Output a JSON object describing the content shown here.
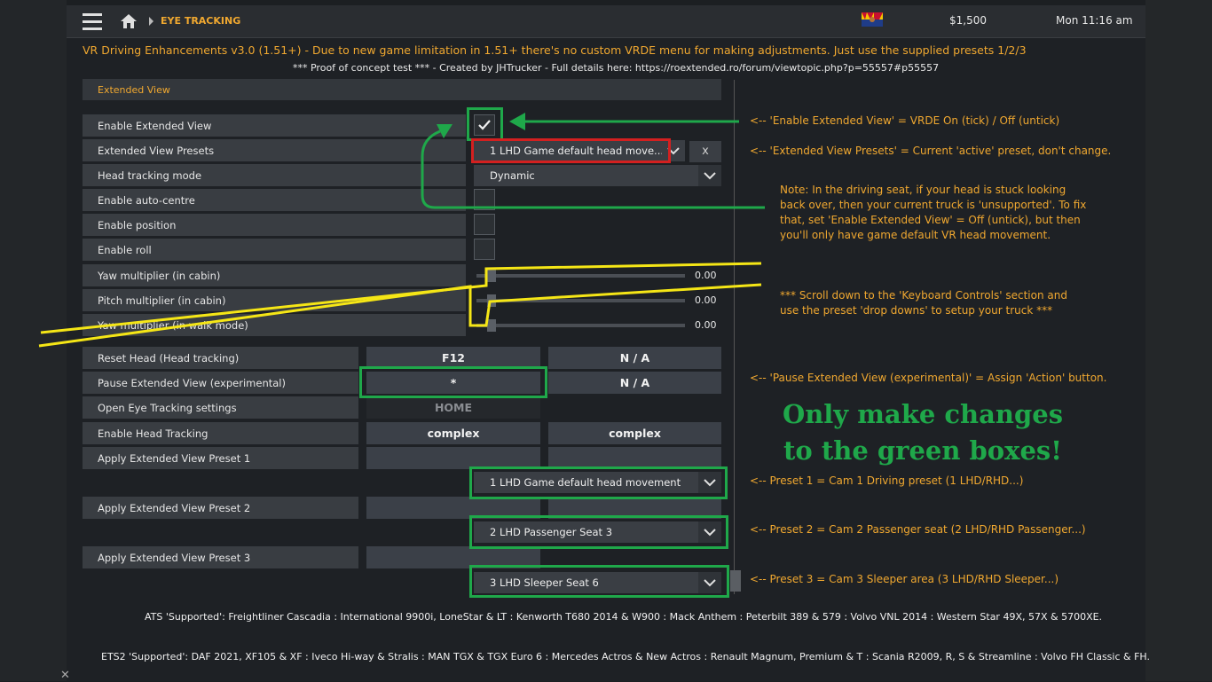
{
  "topbar": {
    "breadcrumb": "EYE TRACKING",
    "money": "$1,500",
    "clock": "Mon 11:16 am"
  },
  "header": {
    "title": "VR Driving Enhancements v3.0 (1.51+) - Due to new game limitation in 1.51+ there's no custom VRDE menu for making adjustments. Just use the supplied presets 1/2/3",
    "subtitle": "*** Proof of concept test *** - Created by JHTrucker - Full details here: https://roextended.ro/forum/viewtopic.php?p=55557#p55557"
  },
  "section": {
    "title": "Extended View"
  },
  "settings": {
    "enable_extended_view": "Enable Extended View",
    "extended_view_presets": "Extended View Presets",
    "preset_value": "1 LHD Game default head move...",
    "preset_clear": "x",
    "head_tracking_mode": "Head tracking mode",
    "head_tracking_value": "Dynamic",
    "enable_auto_centre": "Enable auto-centre",
    "enable_position": "Enable position",
    "enable_roll": "Enable roll",
    "yaw_cabin": "Yaw multiplier (in cabin)",
    "yaw_cabin_value": "0.00",
    "pitch_cabin": "Pitch multiplier (in cabin)",
    "pitch_cabin_value": "0.00",
    "yaw_walk": "Yaw multiplier (in walk mode)",
    "yaw_walk_value": "0.00"
  },
  "controls": {
    "reset_head": "Reset Head (Head tracking)",
    "reset_head_key1": "F12",
    "reset_head_key2": "N / A",
    "pause_view": "Pause Extended View (experimental)",
    "pause_view_key1": "*",
    "pause_view_key2": "N / A",
    "open_eye": "Open Eye Tracking settings",
    "open_eye_key1": "HOME",
    "enable_head": "Enable Head Tracking",
    "enable_head_key1": "complex",
    "enable_head_key2": "complex",
    "preset1": "Apply Extended View Preset 1",
    "preset1_value": "1 LHD Game default head movement",
    "preset2": "Apply Extended View Preset 2",
    "preset2_value": "2 LHD Passenger Seat 3",
    "preset3": "Apply Extended View Preset 3",
    "preset3_value": "3 LHD Sleeper Seat 6"
  },
  "notes": {
    "enable_note": "<-- 'Enable Extended View' = VRDE On (tick) / Off (untick)",
    "presets_note": "<-- 'Extended View Presets' = Current 'active' preset, don't change.",
    "driving_note_1": "Note: In the driving seat, if your head is stuck looking",
    "driving_note_2": "back over, then your current truck is 'unsupported'. To fix",
    "driving_note_3": "that, set 'Enable Extended View' =  Off (untick), but then",
    "driving_note_4": "you'll only have game default VR head movement.",
    "scroll_note_1": "*** Scroll down to the 'Keyboard Controls' section and",
    "scroll_note_2": "use the preset 'drop downs' to setup your truck ***",
    "pause_note": "<-- 'Pause Extended View (experimental)' = Assign 'Action' button.",
    "green_1": "Only make changes",
    "green_2": "to the green boxes!",
    "preset1_note": "<-- Preset 1 = Cam 1 Driving preset (1 LHD/RHD...)",
    "preset2_note": "<-- Preset 2 = Cam 2 Passenger seat (2 LHD/RHD Passenger...)",
    "preset3_note": "<-- Preset 3 = Cam 3 Sleeper area (3 LHD/RHD Sleeper...)"
  },
  "footer": {
    "ats": "ATS 'Supported': Freightliner Cascadia : International 9900i, LoneStar & LT : Kenworth T680 2014 & W900 : Mack Anthem : Peterbilt 389 & 579 : Volvo VNL 2014 : Western Star 49X, 57X & 5700XE.",
    "ets2": "ETS2 'Supported': DAF 2021, XF105 & XF : Iveco Hi-way & Stralis : MAN TGX  & TGX Euro 6 : Mercedes Actros & New Actros : Renault Magnum, Premium & T : Scania R2009, R, S & Streamline : Volvo FH Classic & FH."
  },
  "colors": {
    "accent": "#f0a830",
    "highlight_green": "#1fa84a",
    "highlight_red": "#d32020",
    "annotation_yellow": "#f5e616"
  },
  "icons": [
    "menu-icon",
    "home-icon",
    "chevron-right-icon",
    "arizona-flag-icon",
    "checkmark-icon",
    "chevron-down-icon",
    "close-icon"
  ]
}
